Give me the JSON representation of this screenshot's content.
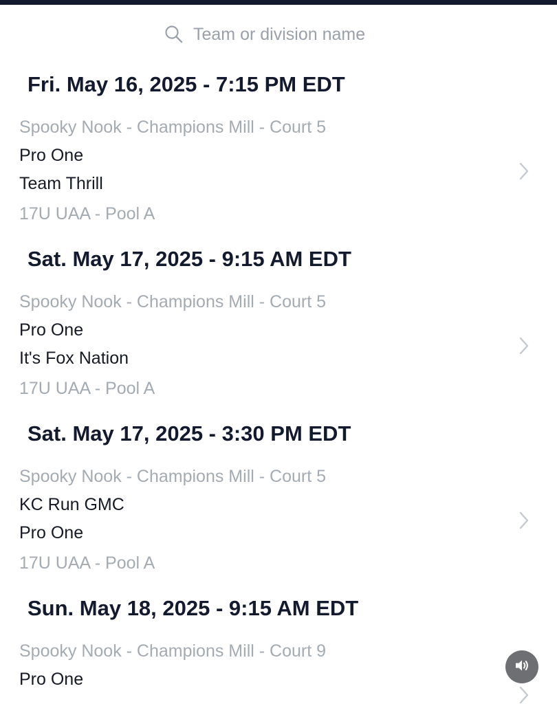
{
  "search": {
    "placeholder": "Team or division name"
  },
  "games": [
    {
      "date": "Fri. May 16, 2025 - 7:15 PM EDT",
      "venue": "Spooky Nook - Champions Mill - Court 5",
      "team1": "Pro One",
      "team2": "Team Thrill",
      "division": "17U UAA - Pool A"
    },
    {
      "date": "Sat. May 17, 2025 - 9:15 AM EDT",
      "venue": "Spooky Nook - Champions Mill - Court 5",
      "team1": "Pro One",
      "team2": "It's Fox Nation",
      "division": "17U UAA - Pool A"
    },
    {
      "date": "Sat. May 17, 2025 - 3:30 PM EDT",
      "venue": "Spooky Nook - Champions Mill - Court 5",
      "team1": "KC Run GMC",
      "team2": "Pro One",
      "division": "17U UAA - Pool A"
    },
    {
      "date": "Sun. May 18, 2025 - 9:15 AM EDT",
      "venue": "Spooky Nook - Champions Mill - Court 9",
      "team1": "Pro One"
    }
  ],
  "icons": {
    "search": "search-icon",
    "chevron": "chevron-right-icon",
    "sound": "speaker-icon"
  },
  "colors": {
    "heading": "#141a2e",
    "muted": "#a4abb2",
    "text": "#161a24",
    "chevron": "#c5cad0",
    "sound_button": "#6e6f73"
  }
}
